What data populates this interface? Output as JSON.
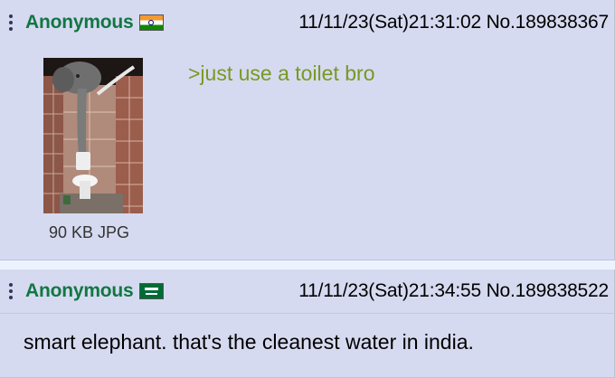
{
  "posts": [
    {
      "name": "Anonymous",
      "flag": "india-flag",
      "datetime": "11/11/23(Sat)21:31:02",
      "post_no": "No.189838367",
      "file_info": "90 KB JPG",
      "greentext": ">just use a toilet bro"
    },
    {
      "name": "Anonymous",
      "flag": "saudi-arabia-flag",
      "datetime": "11/11/23(Sat)21:34:55",
      "post_no": "No.189838522",
      "message": "smart elephant. that's the cleanest water in india."
    }
  ],
  "colors": {
    "page_bg": "#eef2ff",
    "post_bg": "#d6daf0",
    "name": "#117743",
    "greentext": "#789922",
    "text": "#000000"
  },
  "icons": [
    "kebab-menu-icon",
    "india-flag",
    "saudi-arabia-flag"
  ]
}
